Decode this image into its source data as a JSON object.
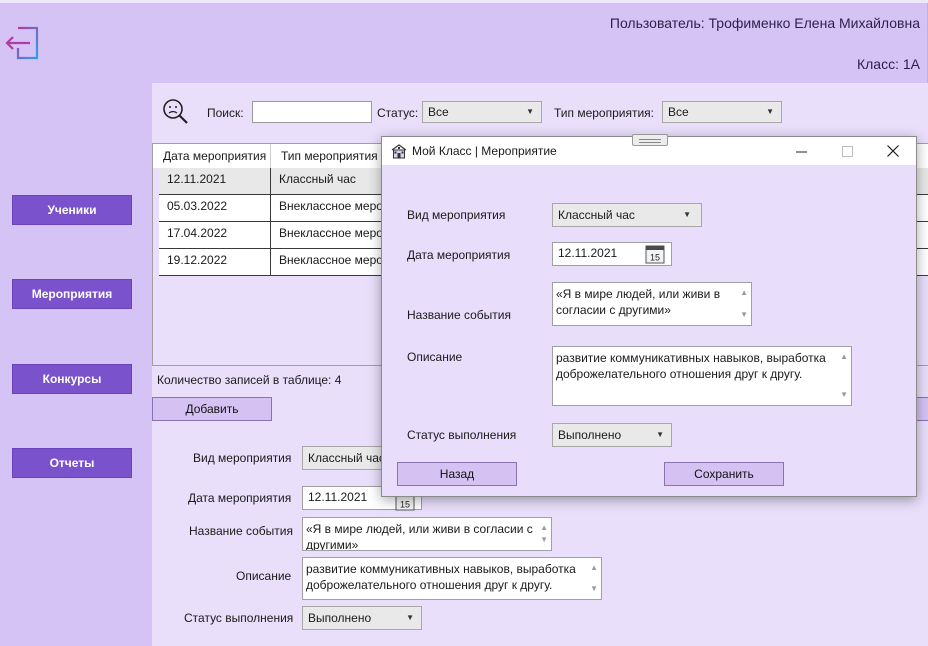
{
  "header": {
    "user_label": "Пользователь: Трофименко Елена Михайловна",
    "class_label": "Класс: 1А"
  },
  "nav": {
    "students": "Ученики",
    "events": "Мероприятия",
    "contests": "Конкурсы",
    "reports": "Отчеты"
  },
  "filters": {
    "search_label": "Поиск:",
    "search_value": "",
    "status_label": "Статус:",
    "status_value": "Все",
    "type_label": "Тип мероприятия:",
    "type_value": "Все"
  },
  "table": {
    "columns": [
      "Дата мероприятия",
      "Тип мероприятия"
    ],
    "rows": [
      {
        "date": "12.11.2021",
        "type": "Классный час"
      },
      {
        "date": "05.03.2022",
        "type": "Внеклассное мероприятие"
      },
      {
        "date": "17.04.2022",
        "type": "Внеклассное мероприятие"
      },
      {
        "date": "19.12.2022",
        "type": "Внеклассное мероприятие"
      }
    ],
    "count_label": "Количество записей в таблице: 4",
    "add_button": "Добавить"
  },
  "form": {
    "type_label": "Вид мероприятия",
    "type_value": "Классный час",
    "date_label": "Дата мероприятия",
    "date_value": "12.11.2021",
    "calendar_day": "15",
    "name_label": "Название события",
    "name_value": "«Я в мире людей, или живи в согласии с другими»",
    "desc_label": "Описание",
    "desc_value": "развитие коммуникативных навыков, выработка доброжелательного отношения друг к другу.",
    "status_label": "Статус выполнения",
    "status_value": "Выполнено"
  },
  "dialog": {
    "title": "Мой Класс | Мероприятие",
    "type_label": "Вид мероприятия",
    "type_value": "Классный час",
    "date_label": "Дата мероприятия",
    "date_value": "12.11.2021",
    "calendar_day": "15",
    "name_label": "Название события",
    "name_value": "«Я в мире людей, или живи в согласии с другими»",
    "desc_label": "Описание",
    "desc_value": "развитие коммуникативных навыков, выработка доброжелательного отношения друг к другу.",
    "status_label": "Статус выполнения",
    "status_value": "Выполнено",
    "back_button": "Назад",
    "save_button": "Сохранить"
  },
  "colors": {
    "background": "#d6c3f5",
    "panel": "#e9dffb",
    "nav_button": "#7a52cc",
    "exit_icon_start": "#2aa1e6",
    "exit_icon_end": "#b13aa4"
  }
}
